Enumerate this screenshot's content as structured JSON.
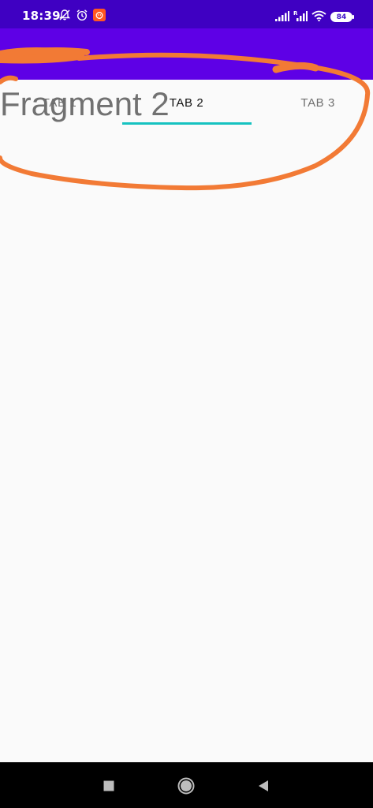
{
  "status_bar": {
    "time": "18:39",
    "battery_level": "84",
    "icons": [
      "notifications-off-icon",
      "alarm-icon",
      "app-notification-icon",
      "signal-icon",
      "signal-roaming-icon",
      "wifi-icon",
      "battery-icon"
    ]
  },
  "colors": {
    "status_bar": "#3f00c2",
    "app_bar": "#5e00e6",
    "tab_indicator": "#16c2c0",
    "annotation": "#f27a35",
    "background": "#fafafa",
    "nav_bar": "#000000"
  },
  "tabs": [
    {
      "label": "TAB 1",
      "selected": false
    },
    {
      "label": "TAB 2",
      "selected": true
    },
    {
      "label": "TAB 3",
      "selected": false
    }
  ],
  "fragment": {
    "title": "Fragment 2"
  },
  "navigation_bar": {
    "buttons": [
      "recent-apps-icon",
      "home-icon",
      "back-icon"
    ]
  }
}
